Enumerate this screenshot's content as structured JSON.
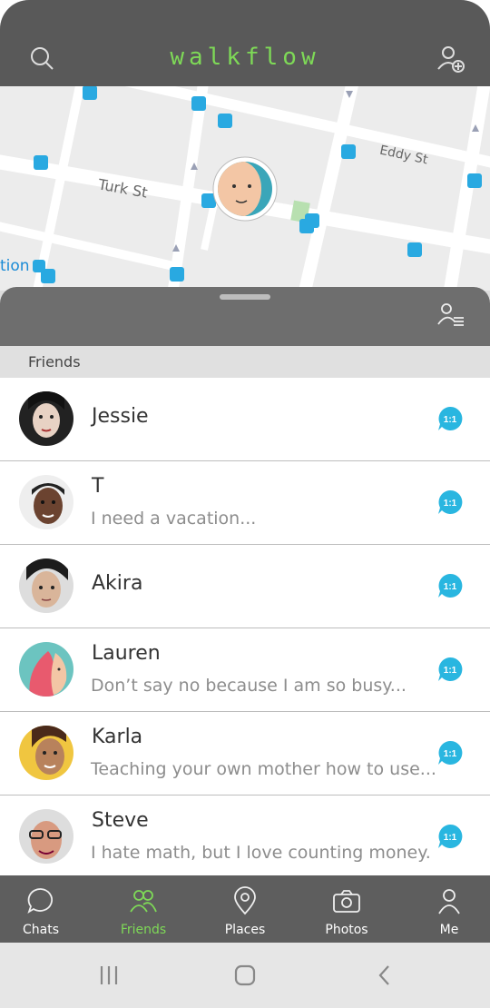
{
  "header": {
    "title": "walkflow",
    "search_icon": "search-icon",
    "add_friend_icon": "add-user-icon"
  },
  "map": {
    "streets": [
      "Turk St",
      "Eddy St"
    ],
    "partial_label": "tion"
  },
  "sheet": {
    "sort_icon": "user-list-icon",
    "section_title": "Friends"
  },
  "friends": [
    {
      "name": "Jessie",
      "message": "",
      "badge": "1:1"
    },
    {
      "name": "T",
      "message": "I need a vacation...",
      "badge": "1:1"
    },
    {
      "name": "Akira",
      "message": "",
      "badge": "1:1"
    },
    {
      "name": "Lauren",
      "message": "Don’t say no because I am so busy...",
      "badge": "1:1"
    },
    {
      "name": "Karla",
      "message": "Teaching your own mother how to use...",
      "badge": "1:1"
    },
    {
      "name": "Steve",
      "message": "I hate math, but I love counting money.",
      "badge": "1:1"
    }
  ],
  "tabs": [
    {
      "label": "Chats",
      "icon": "chat-bubble-icon"
    },
    {
      "label": "Friends",
      "icon": "friends-icon",
      "active": true
    },
    {
      "label": "Places",
      "icon": "location-pin-icon"
    },
    {
      "label": "Photos",
      "icon": "camera-icon"
    },
    {
      "label": "Me",
      "icon": "user-icon"
    }
  ],
  "colors": {
    "accent": "#7ed957",
    "badge": "#29b6e0",
    "header": "#595959"
  }
}
